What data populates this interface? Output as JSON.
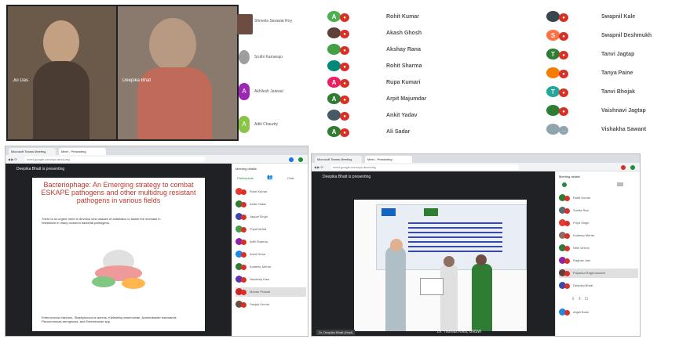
{
  "video_panel": {
    "tile1_name": "Jui Das",
    "tile2_name": "Deepika Bhat",
    "side_tiles": [
      {
        "name": "Shrivela Sarawat Roy",
        "letter": "",
        "color": "#6d4c41"
      },
      {
        "name": "Sruthi Kamaraju",
        "letter": "",
        "color": "#9e9e9e"
      },
      {
        "name": "Akhilesh Jaiswal",
        "letter": "A",
        "color": "#9c27b0"
      },
      {
        "name": "Aditi Chaudry",
        "letter": "A",
        "color": "#8bc34a"
      }
    ]
  },
  "participants_mid": [
    {
      "name": "Rohit Kumar",
      "letter": "A",
      "color": "#4caf50"
    },
    {
      "name": "Akash Ghosh",
      "letter": "",
      "color": "#5d4037"
    },
    {
      "name": "Akshay Rana",
      "letter": "",
      "color": "#43a047"
    },
    {
      "name": "Rohit Sharma",
      "letter": "",
      "color": "#00897b"
    },
    {
      "name": "Rupa Kumari",
      "letter": "A",
      "color": "#e91e63"
    },
    {
      "name": "Arpit Majumdar",
      "letter": "A",
      "color": "#2e7d32"
    },
    {
      "name": "Ankit Yadav",
      "letter": "",
      "color": "#455a64"
    },
    {
      "name": "Ali Sadar",
      "letter": "A",
      "color": "#2e7d32"
    }
  ],
  "participants_right": [
    {
      "name": "Swapnil Kale",
      "letter": "",
      "color": "#37474f"
    },
    {
      "name": "Swapnil Deshmukh",
      "letter": "S",
      "color": "#ff7043"
    },
    {
      "name": "Tanvi Jagtap",
      "letter": "T",
      "color": "#2e7d32"
    },
    {
      "name": "Tanya Paine",
      "letter": "",
      "color": "#f57c00"
    },
    {
      "name": "Tanvi Bhojak",
      "letter": "T",
      "color": "#26a69a"
    },
    {
      "name": "Vaishnavi Jagtap",
      "letter": "",
      "color": "#2e7d32"
    },
    {
      "name": "Vishakha Sawant",
      "letter": "",
      "color": "#90a4ae"
    }
  ],
  "left_browser": {
    "tab1": "Microsoft Teams Meeting",
    "tab2": "Meet - Presenting",
    "url": "meet.google.com/xyz-abcd-efg",
    "presenting_text": "Deepika Bhatt is presenting",
    "slide_title": "Bacteriophage: An Emerging strategy to combat ESKAPE pathogens and other multidrug resistant pathogens in various fields",
    "bullet1": "There is an urgent need to develop new classes of antibiotics to tackle the increase in resistance in many common bacterial pathogens.",
    "bullet2": "Enterococcus faecium, Staphylococcus aureus, Klebsiella pneumoniae, Acinetobacter baumannii, Pseudomonas aeruginosa, and Enterobacter spp.",
    "people_title": "Meeting details",
    "people_tabs": [
      "Participants",
      "Chat"
    ],
    "people": [
      {
        "name": "Rohit Kumar",
        "color": "#e53935"
      },
      {
        "name": "Anita Yadav",
        "color": "#2e7d32"
      },
      {
        "name": "Jaspal Singh",
        "color": "#3949ab"
      },
      {
        "name": "Priya Mehta",
        "color": "#43a047"
      },
      {
        "name": "Aditi Sharma",
        "color": "#8e24aa"
      },
      {
        "name": "Ankit Sinha",
        "color": "#1e88e5"
      },
      {
        "name": "Kuldeep Mehta",
        "color": "#2e7d32"
      },
      {
        "name": "Navdeep Kaur",
        "color": "#5e35b1"
      },
      {
        "name": "Mohan Prasad",
        "color": "#c62828"
      },
      {
        "name": "Sanjay Kumar",
        "color": "#6d4c41"
      }
    ]
  },
  "right_browser": {
    "tab1": "Microsoft Teams Meeting",
    "tab2": "Meet - Presenting",
    "url": "meet.google.com/xyz-abcd-efg",
    "presenting_text": "Deepika Bhatt is presenting",
    "caption": "Dr. Thomas Kvist, UNSW",
    "footer_text": "Dr. Deepika Bhatt (Host)",
    "people_title": "Meeting details",
    "people": [
      {
        "name": "Rohit Kumar",
        "color": "#2e7d32"
      },
      {
        "name": "Sunita Rao",
        "color": "#546e7a"
      },
      {
        "name": "Priya Singh",
        "color": "#e53935"
      },
      {
        "name": "Kuldeep Mehta",
        "color": "#8d6e63"
      },
      {
        "name": "Nitin Verma",
        "color": "#2e7d32"
      },
      {
        "name": "Raghav Jain",
        "color": "#8e24aa"
      },
      {
        "name": "Priyanka Raghuwanshi",
        "color": "#5d4037"
      },
      {
        "name": "Deepika Bhatt",
        "color": "#3949ab"
      },
      {
        "name": "Anjali Bose",
        "color": "#1e88e5"
      }
    ]
  }
}
